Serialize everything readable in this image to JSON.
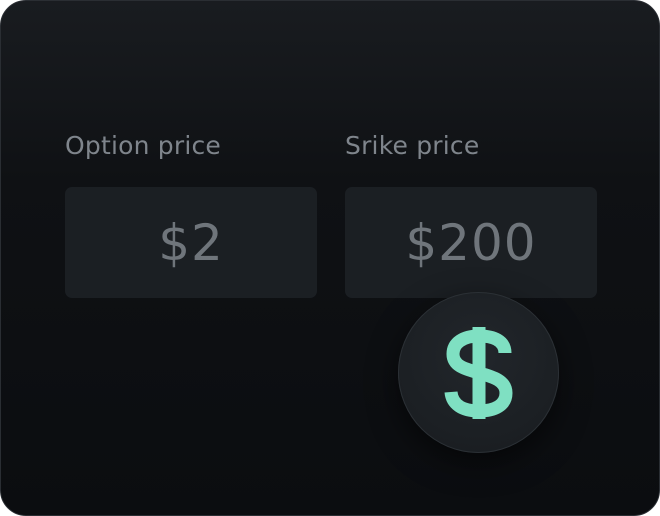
{
  "fields": {
    "option": {
      "label": "Option price",
      "value": "$2"
    },
    "strike": {
      "label": "Srike price",
      "value": "$200"
    }
  },
  "badge": {
    "icon": "dollar-sign-icon",
    "color": "#7fe0c2"
  },
  "colors": {
    "card_background": "#0f1114",
    "field_background": "#1b1f23",
    "label_text": "#7f858c",
    "value_text": "#6f757b",
    "accent": "#7fe0c2"
  }
}
